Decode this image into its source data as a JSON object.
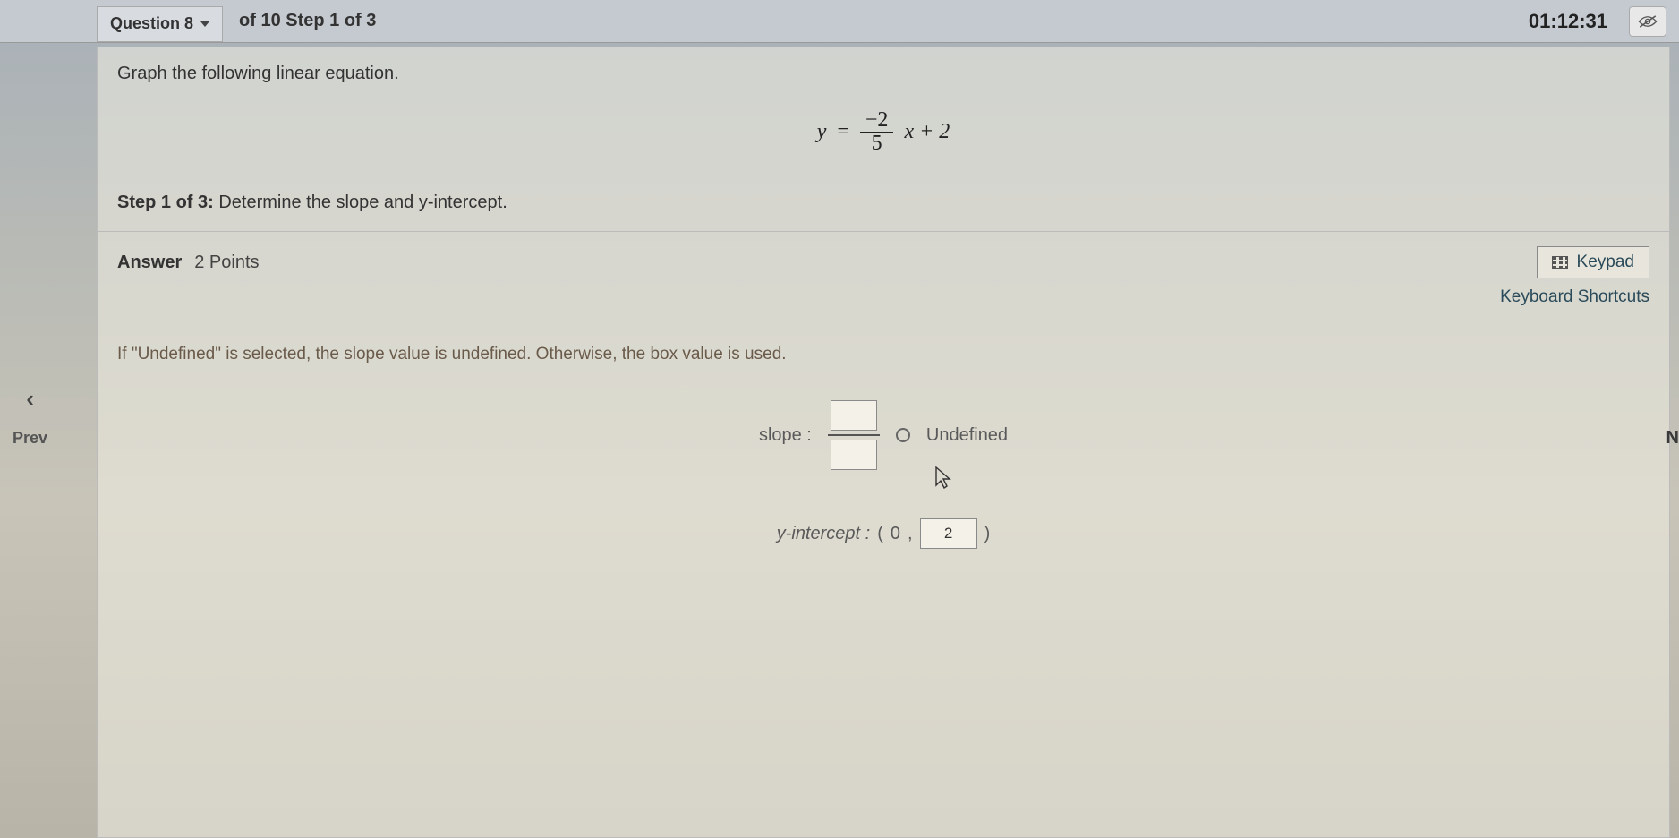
{
  "header": {
    "question_label": "Question 8",
    "step_info": "of 10 Step 1 of 3",
    "timer": "01:12:31"
  },
  "question": {
    "prompt": "Graph the following linear equation.",
    "equation": {
      "lhs": "y",
      "eq": "=",
      "numerator": "−2",
      "denominator": "5",
      "suffix": "x + 2"
    },
    "step_label": "Step 1 of 3:",
    "step_text": "Determine the slope and y-intercept."
  },
  "answer": {
    "label": "Answer",
    "points": "2 Points",
    "keypad": "Keypad",
    "keyboard_shortcuts": "Keyboard Shortcuts",
    "hint": "If \"Undefined\" is selected, the slope value is undefined. Otherwise, the box value is used.",
    "slope_label": "slope :",
    "slope_num": "",
    "slope_den": "",
    "undefined_label": "Undefined",
    "yint_label": "y-intercept :",
    "yint_x": "0",
    "yint_y": "2"
  },
  "nav": {
    "prev": "Prev",
    "next": "N"
  }
}
